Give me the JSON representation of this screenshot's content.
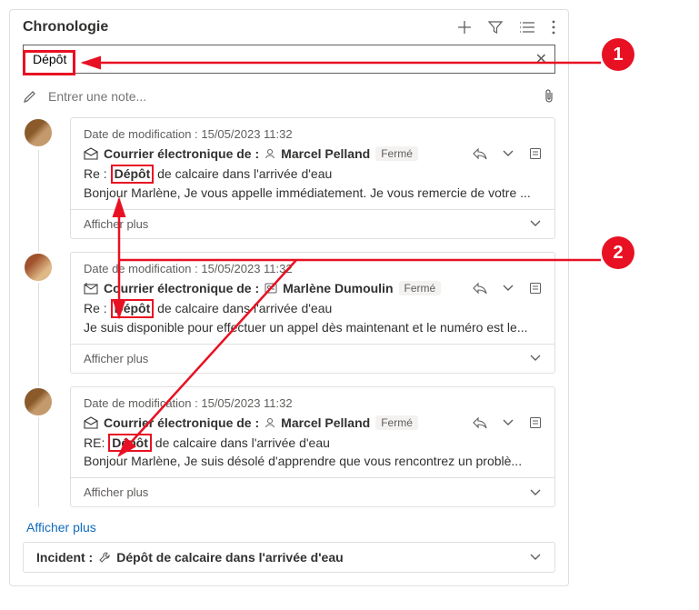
{
  "header": {
    "title": "Chronologie"
  },
  "search": {
    "value": "Dépôt"
  },
  "note": {
    "placeholder": "Entrer une note..."
  },
  "labels": {
    "mod_prefix": "Date de modification : ",
    "from_label": "Courrier électronique de :",
    "show_more": "Afficher plus",
    "footer_more": "Afficher plus",
    "incident_label": "Incident :",
    "status_closed": "Fermé"
  },
  "entries": [
    {
      "mod": "15/05/2023 11:32",
      "sender": "Marcel Pelland",
      "subject_prefix": "Re : ",
      "subject_hl": "Dépôt",
      "subject_rest": " de calcaire dans l'arrivée d'eau",
      "preview": "Bonjour Marlène, Je vous appelle immédiatement. Je vous remercie de votre ..."
    },
    {
      "mod": "15/05/2023 11:32",
      "sender": "Marlène Dumoulin",
      "subject_prefix": "Re : ",
      "subject_hl": "Dépôt",
      "subject_rest": " de calcaire dans l'arrivée d'eau",
      "preview": "Je suis disponible pour effectuer un appel dès maintenant et le numéro est le..."
    },
    {
      "mod": "15/05/2023 11:32",
      "sender": "Marcel Pelland",
      "subject_prefix": "RE: ",
      "subject_hl": "Dépôt",
      "subject_rest": " de calcaire dans l'arrivée d'eau",
      "preview": "Bonjour Marlène, Je suis désolé d'apprendre que vous rencontrez un problè..."
    }
  ],
  "incident": {
    "title": "Dépôt de calcaire dans l'arrivée d'eau"
  },
  "callouts": {
    "one": "1",
    "two": "2"
  }
}
